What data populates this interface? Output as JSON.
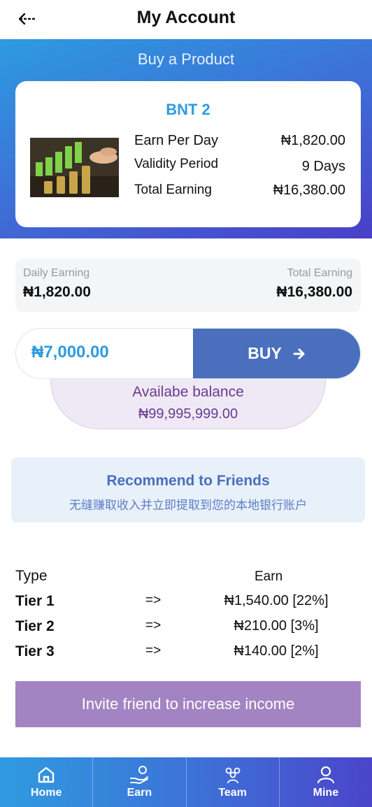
{
  "header": {
    "title": "My Account",
    "back_icon": "arrow-left-icon"
  },
  "hero": {
    "title": "Buy a Product"
  },
  "product": {
    "name": "BNT 2",
    "earn_per_day_label": "Earn Per Day",
    "earn_per_day_value": "₦1,820.00",
    "validity_label": "Validity Period",
    "validity_value": "9 Days",
    "total_label": "Total Earning",
    "total_value": "₦16,380.00"
  },
  "stats": {
    "daily_label": "Daily Earning",
    "daily_value": "₦1,820.00",
    "total_label": "Total Earning",
    "total_value": "₦16,380.00"
  },
  "buy": {
    "price": "₦7,000.00",
    "button_label": "BUY",
    "button_icon": "arrow-right-icon"
  },
  "balance": {
    "label": "Availabe balance",
    "value": "₦99,995,999.00"
  },
  "recommend": {
    "title": "Recommend to Friends",
    "subtitle": "无缝赚取收入并立即提取到您的本地银行账户"
  },
  "tiers": {
    "type_header": "Type",
    "earn_header": "Earn",
    "rows": [
      {
        "name": "Tier 1",
        "arrow": "=>",
        "value": "₦1,540.00 [22%]"
      },
      {
        "name": "Tier 2",
        "arrow": "=>",
        "value": "₦210.00 [3%]"
      },
      {
        "name": "Tier 3",
        "arrow": "=>",
        "value": "₦140.00 [2%]"
      }
    ]
  },
  "invite": {
    "label": "Invite friend to increase income"
  },
  "nav": {
    "items": [
      {
        "label": "Home",
        "icon": "home-icon"
      },
      {
        "label": "Earn",
        "icon": "hand-coin-icon"
      },
      {
        "label": "Team",
        "icon": "team-icon"
      },
      {
        "label": "Mine",
        "icon": "user-icon"
      }
    ]
  },
  "colors": {
    "accent_blue": "#2f9be0",
    "buy_button": "#4a6fbd",
    "balance_text": "#6a3b91",
    "invite_button": "#a384c2"
  }
}
